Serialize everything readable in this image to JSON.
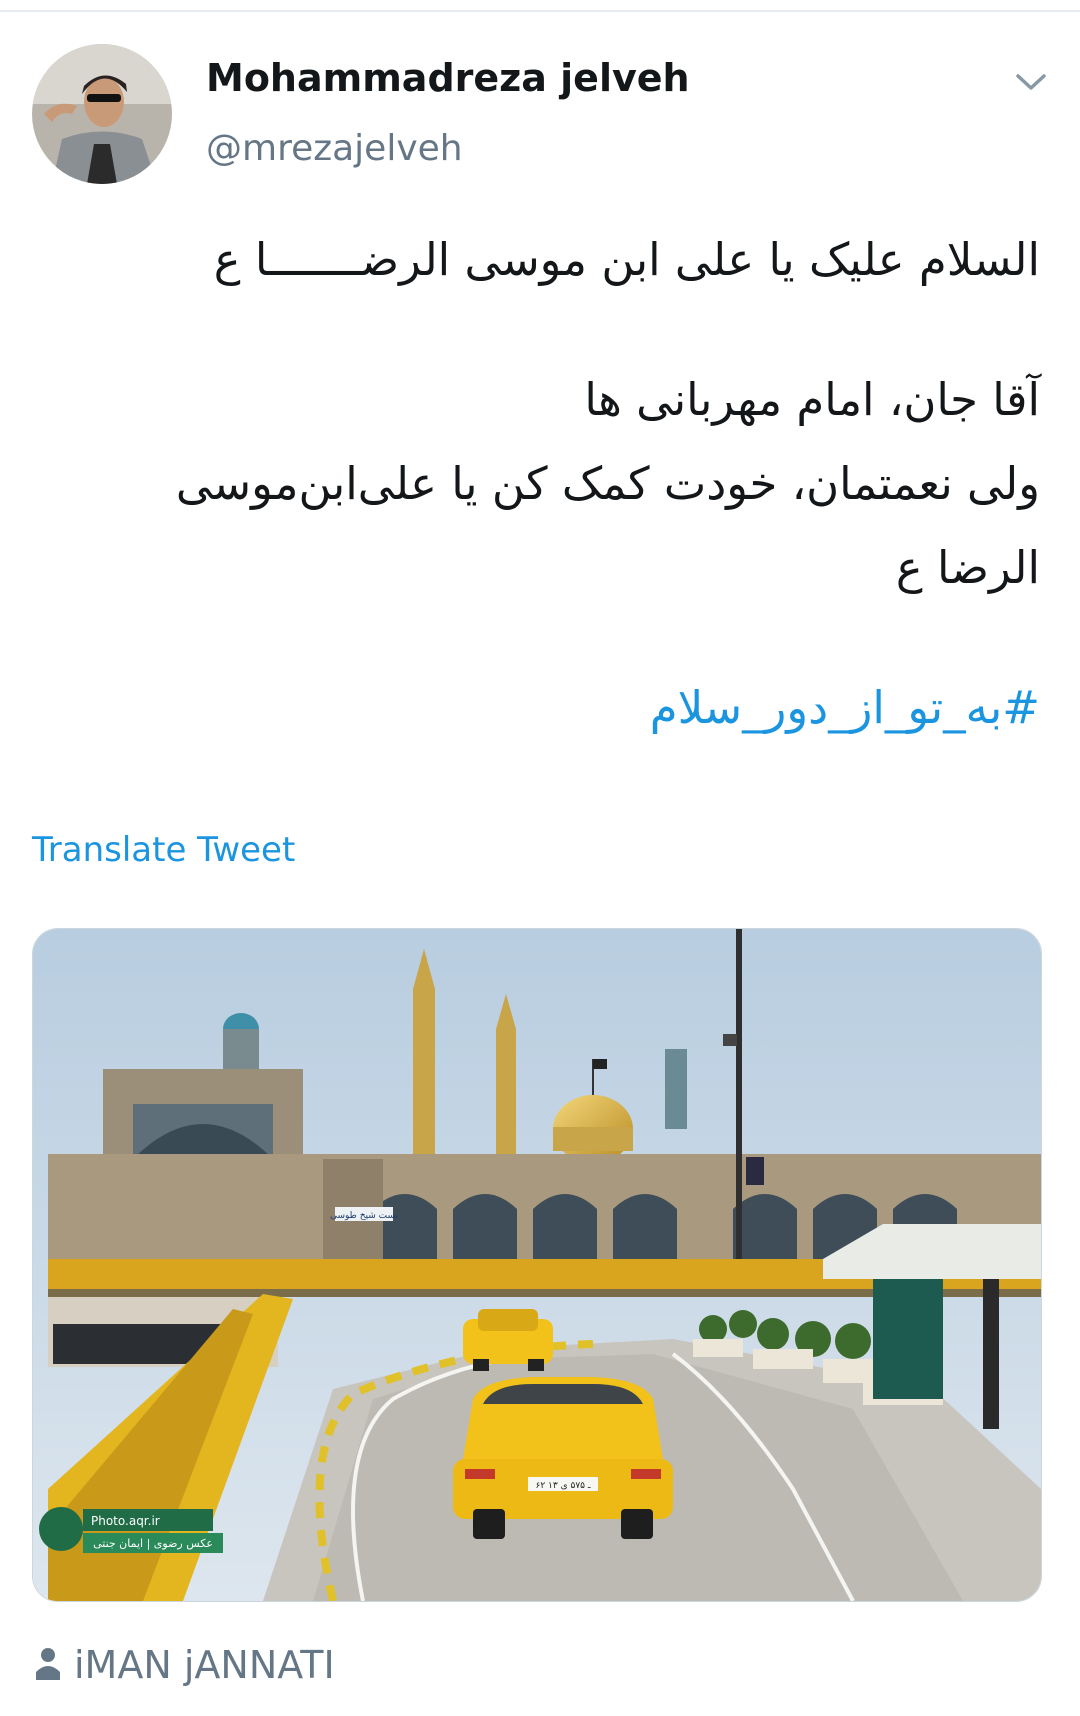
{
  "author": {
    "display_name": "Mohammadreza jelveh",
    "handle": "@mrezajelveh"
  },
  "tweet": {
    "lines": [
      "السلام علیک یا علی ابن موسی الرضـــــــا ع",
      "آقا جان، امام مهربانی ها",
      "ولی نعمتمان، خودت کمک کن یا علی‌ابن‌موسی",
      "الرضا ع"
    ],
    "hashtag": "#به_تو_از_دور_سلام"
  },
  "actions": {
    "translate_label": "Translate Tweet"
  },
  "photo": {
    "watermark_site": "Photo.aqr.ir",
    "watermark_caption": "عکس رضوی | ایمان جنتی",
    "sign_text": "بست شیخ طوسی",
    "plate_text": "۶۲ ـ ۵۷۵ ی ۱۳"
  },
  "media_credit": {
    "icon": "person-icon",
    "name": "iMAN jANNATI"
  },
  "colors": {
    "link": "#1b95e0",
    "secondary_text": "#657786",
    "primary_text": "#14171a"
  }
}
